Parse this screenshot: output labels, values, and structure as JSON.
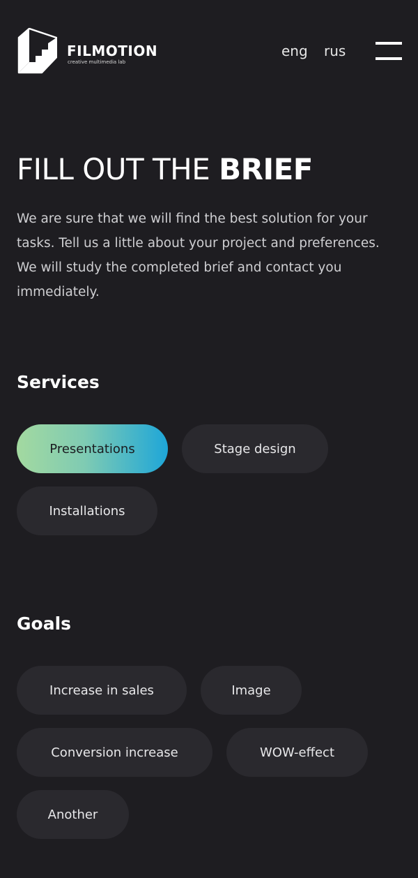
{
  "header": {
    "logo_name": "FILMOTION",
    "logo_tagline": "creative multimedia lab",
    "languages": [
      "eng",
      "rus"
    ]
  },
  "hero": {
    "title_regular": "FILL OUT THE ",
    "title_bold": "BRIEF",
    "intro": "We are sure that we will find the best solution for your tasks. Tell us a little about your project and preferences. We will study the completed brief and contact you immediately."
  },
  "services": {
    "heading": "Services",
    "options": [
      {
        "label": "Presentations",
        "selected": true
      },
      {
        "label": "Stage design",
        "selected": false
      },
      {
        "label": "Installations",
        "selected": false
      }
    ]
  },
  "goals": {
    "heading": "Goals",
    "options": [
      {
        "label": "Increase in sales",
        "selected": false
      },
      {
        "label": "Image",
        "selected": false
      },
      {
        "label": "Conversion increase",
        "selected": false
      },
      {
        "label": "WOW-effect",
        "selected": false
      },
      {
        "label": "Another",
        "selected": false
      }
    ]
  },
  "colors": {
    "background": "#1e1d21",
    "chip": "#2a292e",
    "accent_gradient_start": "#a3d9a0",
    "accent_gradient_end": "#1ea6d8"
  }
}
